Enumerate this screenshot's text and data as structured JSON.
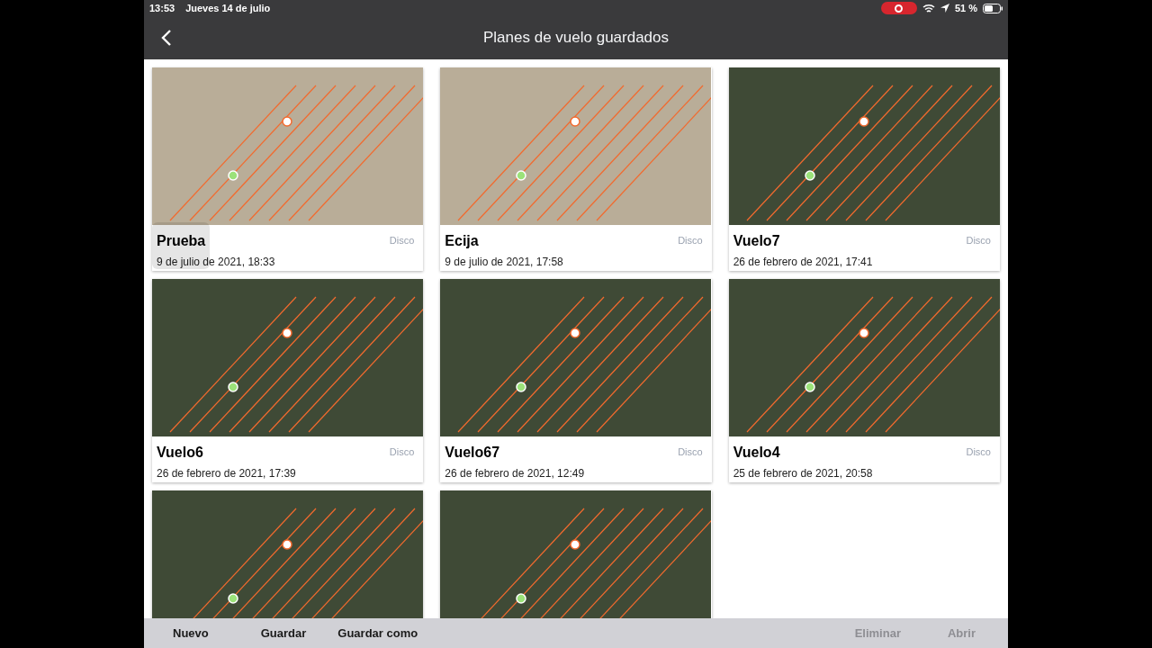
{
  "status_bar": {
    "time": "13:53",
    "date": "Jueves 14 de julio",
    "battery": "51 %"
  },
  "header": {
    "title": "Planes de vuelo guardados"
  },
  "plans": [
    {
      "title": "Prueba",
      "source": "Disco",
      "date": "9 de julio de 2021, 18:33",
      "kind": "farmland",
      "pressed": true
    },
    {
      "title": "Ecija",
      "source": "Disco",
      "date": "9 de julio de 2021, 17:58",
      "kind": "farmland",
      "pressed": false
    },
    {
      "title": "Vuelo7",
      "source": "Disco",
      "date": "26 de febrero de 2021, 17:41",
      "kind": "forest",
      "pressed": false
    },
    {
      "title": "Vuelo6",
      "source": "Disco",
      "date": "26 de febrero de 2021, 17:39",
      "kind": "forest",
      "pressed": false
    },
    {
      "title": "Vuelo67",
      "source": "Disco",
      "date": "26 de febrero de 2021, 12:49",
      "kind": "forest",
      "pressed": false
    },
    {
      "title": "Vuelo4",
      "source": "Disco",
      "date": "25 de febrero de 2021, 20:58",
      "kind": "forest",
      "pressed": false
    },
    {
      "kind": "forest",
      "pressed": false
    },
    {
      "kind": "forest",
      "pressed": false
    }
  ],
  "toolbar": [
    {
      "label": "Nuevo",
      "disabled": false
    },
    {
      "label": "Guardar",
      "disabled": false
    },
    {
      "label": "Guardar como",
      "disabled": false
    },
    {
      "label": "Eliminar",
      "disabled": true
    },
    {
      "label": "Abrir",
      "disabled": true
    }
  ]
}
